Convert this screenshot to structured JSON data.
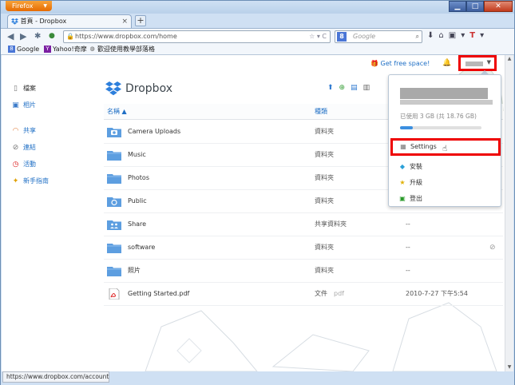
{
  "browser": {
    "app_button": "Firefox",
    "tab_title": "首頁 - Dropbox",
    "url": "https://www.dropbox.com/home",
    "search_placeholder": "Google",
    "bookmarks": [
      "Google",
      "Yahoo!奇摩",
      "歡迎使用教學部落格"
    ],
    "status_url": "https://www.dropbox.com/account"
  },
  "topbar": {
    "free_space": "Get free space!"
  },
  "sidebar": {
    "items": [
      {
        "label": "檔案",
        "icon": "file-icon"
      },
      {
        "label": "相片",
        "icon": "photo-icon"
      },
      {
        "label": "共享",
        "icon": "rainbow-icon"
      },
      {
        "label": "連結",
        "icon": "paperclip-icon"
      },
      {
        "label": "活動",
        "icon": "clock-icon"
      },
      {
        "label": "新手指南",
        "icon": "guide-icon"
      }
    ]
  },
  "main": {
    "brand": "Dropbox",
    "columns": {
      "name": "名稱 ▲",
      "kind": "種類"
    },
    "rows": [
      {
        "name": "Camera Uploads",
        "kind": "資料夾",
        "ext": "",
        "modified": "",
        "icon": "camera-folder-icon"
      },
      {
        "name": "Music",
        "kind": "資料夾",
        "ext": "",
        "modified": "",
        "icon": "folder-icon"
      },
      {
        "name": "Photos",
        "kind": "資料夾",
        "ext": "",
        "modified": "",
        "icon": "folder-icon"
      },
      {
        "name": "Public",
        "kind": "資料夾",
        "ext": "",
        "modified": "",
        "icon": "public-folder-icon"
      },
      {
        "name": "Share",
        "kind": "共享資料夾",
        "ext": "",
        "modified": "--",
        "icon": "shared-folder-icon"
      },
      {
        "name": "software",
        "kind": "資料夾",
        "ext": "",
        "modified": "--",
        "icon": "folder-icon"
      },
      {
        "name": "照片",
        "kind": "資料夾",
        "ext": "",
        "modified": "--",
        "icon": "folder-icon"
      },
      {
        "name": "Getting Started.pdf",
        "kind": "文件",
        "ext": "pdf",
        "modified": "2010-7-27 下午5:54",
        "icon": "pdf-icon"
      }
    ]
  },
  "account_menu": {
    "usage": "已使用 3 GB (共 18.76 GB)",
    "usage_fraction": 0.16,
    "items": [
      {
        "label": "Settings",
        "icon": "settings-icon"
      },
      {
        "label": "安裝",
        "icon": "install-icon"
      },
      {
        "label": "升級",
        "icon": "star-icon"
      },
      {
        "label": "登出",
        "icon": "logout-icon"
      }
    ]
  },
  "colors": {
    "accent": "#1f6fc5",
    "highlight": "#e00000"
  }
}
